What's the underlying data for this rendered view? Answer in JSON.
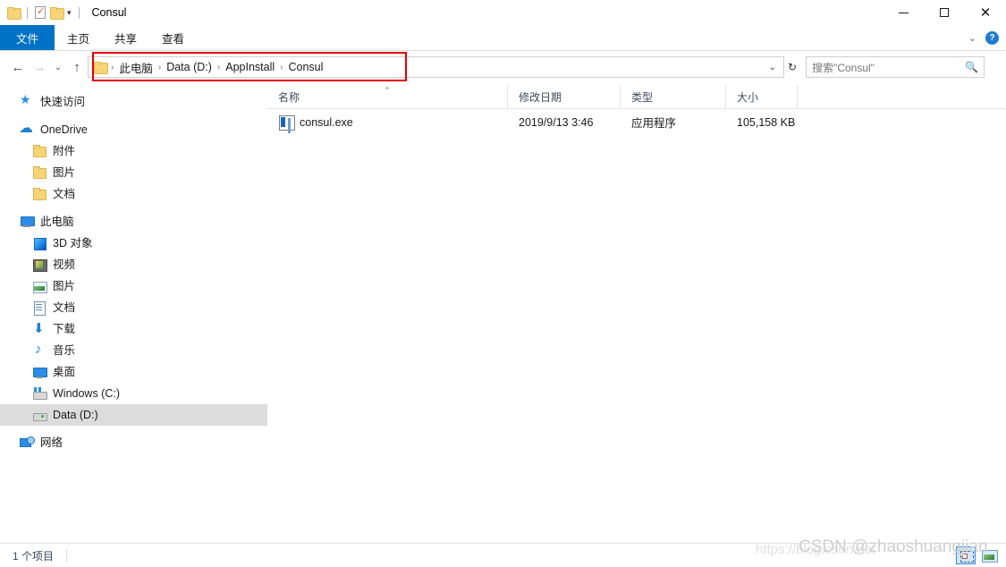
{
  "window": {
    "title": "Consul",
    "quick_access": [
      {
        "name": "folder-icon",
        "label": ""
      },
      {
        "name": "properties-icon",
        "label": ""
      },
      {
        "name": "new-folder-icon",
        "label": ""
      },
      {
        "name": "customize-caret",
        "label": "▾"
      }
    ],
    "controls": {
      "minimize": "minimize-icon",
      "maximize": "maximize-icon",
      "close": "close-icon"
    }
  },
  "ribbon": {
    "tabs": [
      {
        "label": "文件",
        "active": true
      },
      {
        "label": "主页",
        "active": false
      },
      {
        "label": "共享",
        "active": false
      },
      {
        "label": "查看",
        "active": false
      }
    ],
    "collapse_caret": "⌄",
    "help_label": "?"
  },
  "navbar": {
    "back": "←",
    "forward": "→",
    "recent": "⌄",
    "up": "↑",
    "breadcrumbs": [
      "此电脑",
      "Data (D:)",
      "AppInstall",
      "Consul"
    ],
    "separator": "›",
    "dropdown_caret": "⌄",
    "refresh": "↻"
  },
  "search": {
    "placeholder": "搜索\"Consul\"",
    "icon": "search-icon"
  },
  "sidebar": {
    "items": [
      {
        "label": "快速访问",
        "icon": "pin-star-icon",
        "indent": 0,
        "selected": false
      },
      {
        "label": "OneDrive",
        "icon": "cloud-icon",
        "indent": 0,
        "selected": false
      },
      {
        "label": "附件",
        "icon": "folder-icon",
        "indent": 1,
        "selected": false
      },
      {
        "label": "图片",
        "icon": "folder-icon",
        "indent": 1,
        "selected": false
      },
      {
        "label": "文档",
        "icon": "folder-icon",
        "indent": 1,
        "selected": false
      },
      {
        "label": "此电脑",
        "icon": "computer-icon",
        "indent": 0,
        "selected": false
      },
      {
        "label": "3D 对象",
        "icon": "3d-objects-icon",
        "indent": 1,
        "selected": false
      },
      {
        "label": "视频",
        "icon": "videos-icon",
        "indent": 1,
        "selected": false
      },
      {
        "label": "图片",
        "icon": "pictures-icon",
        "indent": 1,
        "selected": false
      },
      {
        "label": "文档",
        "icon": "documents-icon",
        "indent": 1,
        "selected": false
      },
      {
        "label": "下载",
        "icon": "downloads-icon",
        "indent": 1,
        "selected": false
      },
      {
        "label": "音乐",
        "icon": "music-icon",
        "indent": 1,
        "selected": false
      },
      {
        "label": "桌面",
        "icon": "desktop-icon",
        "indent": 1,
        "selected": false
      },
      {
        "label": "Windows (C:)",
        "icon": "system-drive-icon",
        "indent": 1,
        "selected": false
      },
      {
        "label": "Data (D:)",
        "icon": "drive-icon",
        "indent": 1,
        "selected": true
      },
      {
        "label": "网络",
        "icon": "network-icon",
        "indent": 0,
        "selected": false
      }
    ]
  },
  "filelist": {
    "columns": [
      {
        "label": "名称",
        "sorted": "asc",
        "sort_caret": "⌃"
      },
      {
        "label": "修改日期",
        "sorted": ""
      },
      {
        "label": "类型",
        "sorted": ""
      },
      {
        "label": "大小",
        "sorted": ""
      }
    ],
    "rows": [
      {
        "name": "consul.exe",
        "icon": "application-exe-icon",
        "modified": "2019/9/13 3:46",
        "type": "应用程序",
        "size": "105,158 KB"
      }
    ]
  },
  "statusbar": {
    "item_count": "1 个项目",
    "view_details": "details-view-icon",
    "view_large_icons": "large-icons-view-icon"
  },
  "watermark": {
    "url": "https://blog.csdn.net",
    "credit": "CSDN @zhaoshuangjian"
  },
  "colors": {
    "accent": "#0072c6",
    "annotation": "#e60000",
    "selection": "#dcdcdc",
    "folder": "#f6d477"
  }
}
